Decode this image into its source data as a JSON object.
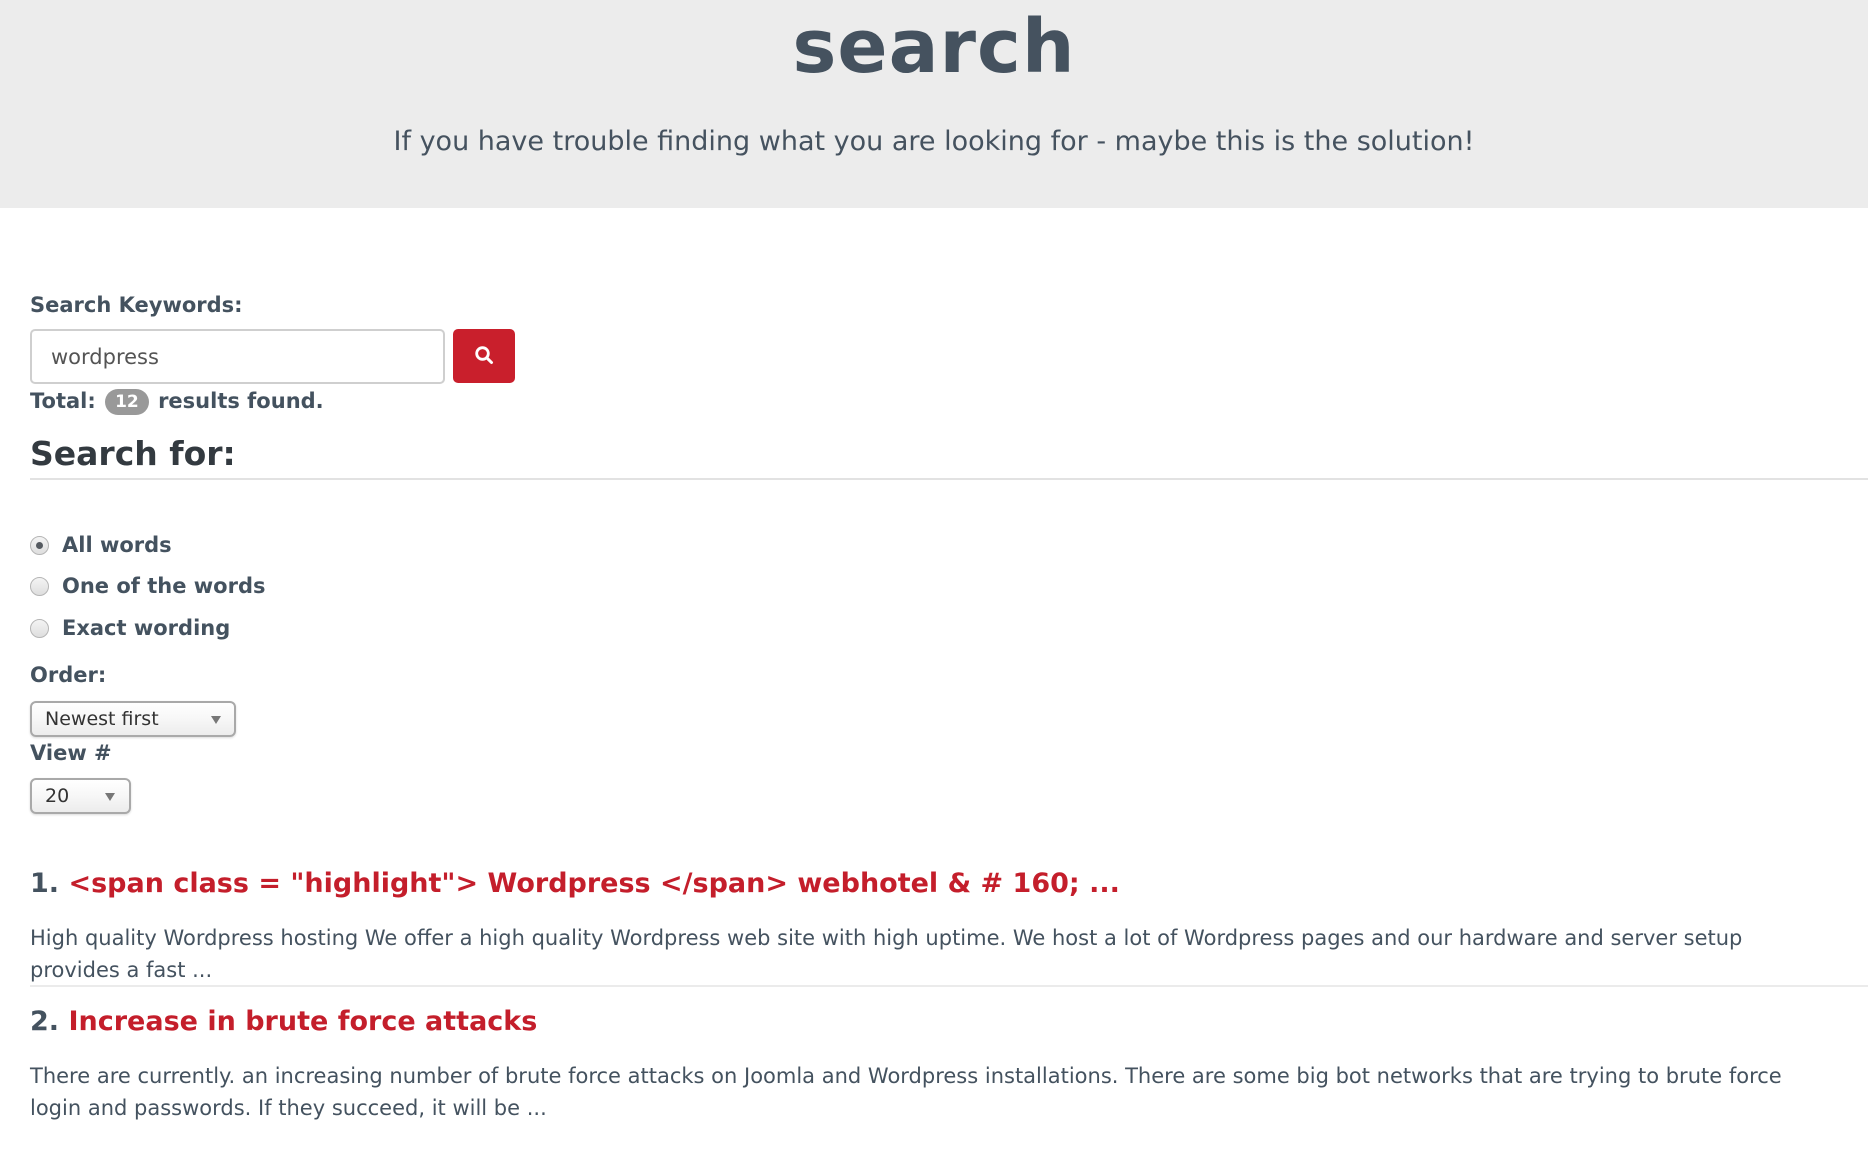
{
  "hero": {
    "title": "search",
    "subtitle": "If you have trouble finding what you are looking for - maybe this is the solution!"
  },
  "search": {
    "keywords_label": "Search Keywords:",
    "input_value": "wordpress",
    "button_icon": "search-icon",
    "total_prefix": "Total:",
    "total_count": "12",
    "total_suffix": "results found."
  },
  "search_for": {
    "title": "Search for:",
    "options": [
      {
        "label": "All words",
        "checked": true
      },
      {
        "label": "One of the words",
        "checked": false
      },
      {
        "label": "Exact wording",
        "checked": false
      }
    ]
  },
  "order": {
    "label": "Order:",
    "selected": "Newest first"
  },
  "view": {
    "label": "View #",
    "selected": "20"
  },
  "results": [
    {
      "number": "1.",
      "title": "<span class = \"highlight\"> Wordpress </span> webhotel & # 160; ...",
      "description": "High quality Wordpress hosting We offer a high quality Wordpress web site with high uptime. We host a lot of Wordpress pages and our hardware and server setup provides a fast ..."
    },
    {
      "number": "2.",
      "title": "Increase in brute force attacks",
      "description": "There are currently. an increasing number of brute force attacks on Joomla and Wordpress installations. There are some big bot networks that are trying to brute force login and passwords. If they succeed, it will be ..."
    }
  ],
  "colors": {
    "accent": "#c91f2c",
    "link": "#c41e2b",
    "text": "#44525f",
    "hero_bg": "#ececec",
    "badge_bg": "#999999"
  }
}
